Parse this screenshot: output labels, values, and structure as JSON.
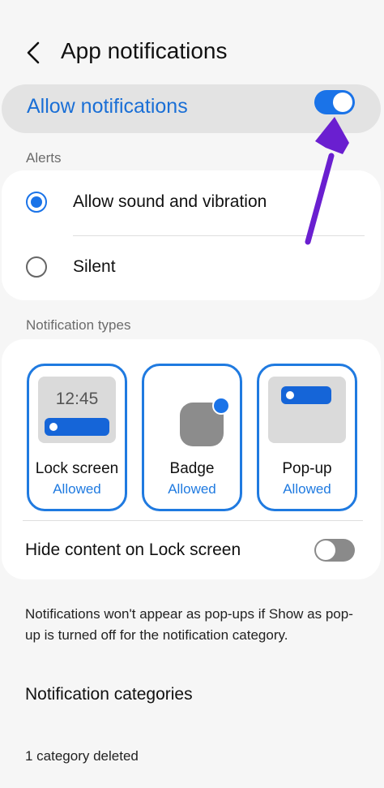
{
  "header": {
    "title": "App notifications"
  },
  "allow": {
    "label": "Allow notifications",
    "enabled": true
  },
  "alerts": {
    "section_label": "Alerts",
    "options": [
      {
        "label": "Allow sound and vibration",
        "selected": true
      },
      {
        "label": "Silent",
        "selected": false
      }
    ]
  },
  "notification_types": {
    "section_label": "Notification types",
    "items": [
      {
        "name": "Lock screen",
        "status": "Allowed",
        "preview_time": "12:45"
      },
      {
        "name": "Badge",
        "status": "Allowed"
      },
      {
        "name": "Pop-up",
        "status": "Allowed"
      }
    ]
  },
  "hide_content": {
    "label": "Hide content on Lock screen",
    "enabled": false
  },
  "info_text": "Notifications won't appear as pop-ups if Show as pop-up is turned off for the notification category.",
  "categories": {
    "title": "Notification categories",
    "deleted_text": "1 category deleted"
  },
  "colors": {
    "accent": "#1a73e8",
    "annotation_arrow": "#6a1fd0"
  }
}
